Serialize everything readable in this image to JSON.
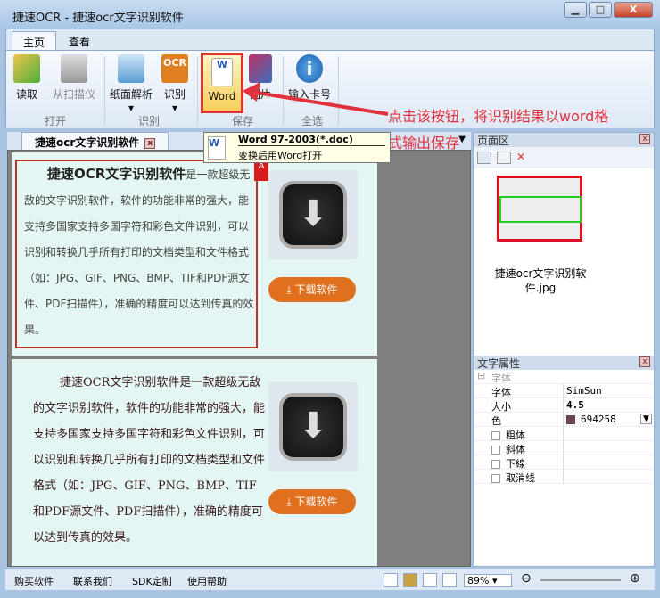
{
  "window": {
    "title": "捷速OCR - 捷速ocr文字识别软件",
    "min": "▁",
    "max": "□",
    "close": "X"
  },
  "ribbon": {
    "tabs": [
      "主页",
      "查看"
    ],
    "buttons": {
      "read": "读取",
      "scanner": "从扫描仪",
      "layout": "纸面解析",
      "recognize": "识别",
      "word": "Word",
      "image": "图片",
      "card": "输入卡号"
    },
    "groups": {
      "open": "打开",
      "recog": "识别",
      "save": "保存",
      "selectall": "全选"
    }
  },
  "annotation": {
    "line1": "点击该按钮，将识别结果以word格",
    "line2": "式输出保存"
  },
  "tooltip": {
    "title": "Word 97-2003(*.doc)",
    "desc": "变换后用Word打开"
  },
  "document": {
    "tab": "捷速ocr文字识别软件",
    "original": {
      "title": "捷速OCR文字识别软件",
      "text": "是一款超级无敌的文字识别软件，软件的功能非常的强大，能支持多国家支持多国字符和彩色文件识别，可以识别和转换几乎所有打印的文档类型和文件格式（如：JPG、GIF、PNG、BMP、TIF和PDF源文件、PDF扫描件），准确的精度可以达到传真的效果。",
      "button": "下载软件"
    },
    "recognized": {
      "text": "捷速OCR文字识别软件是一款超级无敌的文字识别软件，软件的功能非常的强大，能支持多国家支持多国字符和彩色文件识别，可以识别和转换几乎所有打印的文档类型和文件格式（如：JPG、GIF、PNG、BMP、TIF和PDF源文件、PDF扫描件），准确的精度可以达到传真的效果。",
      "button": "下载软件"
    }
  },
  "page_panel": {
    "title": "页面区",
    "thumb_label": "捷速ocr文字识别软件.jpg"
  },
  "text_props": {
    "title": "文字属性",
    "section": "字体",
    "rows": [
      {
        "k": "字体",
        "v": "SimSun"
      },
      {
        "k": "大小",
        "v": "4.5"
      },
      {
        "k": "色",
        "v": "694258"
      }
    ],
    "checks": [
      "粗体",
      "斜体",
      "下線",
      "取消线"
    ],
    "color": "#694258"
  },
  "status": {
    "links": [
      "购买软件",
      "联系我们",
      "SDK定制",
      "使用帮助"
    ],
    "zoom": "89%"
  }
}
